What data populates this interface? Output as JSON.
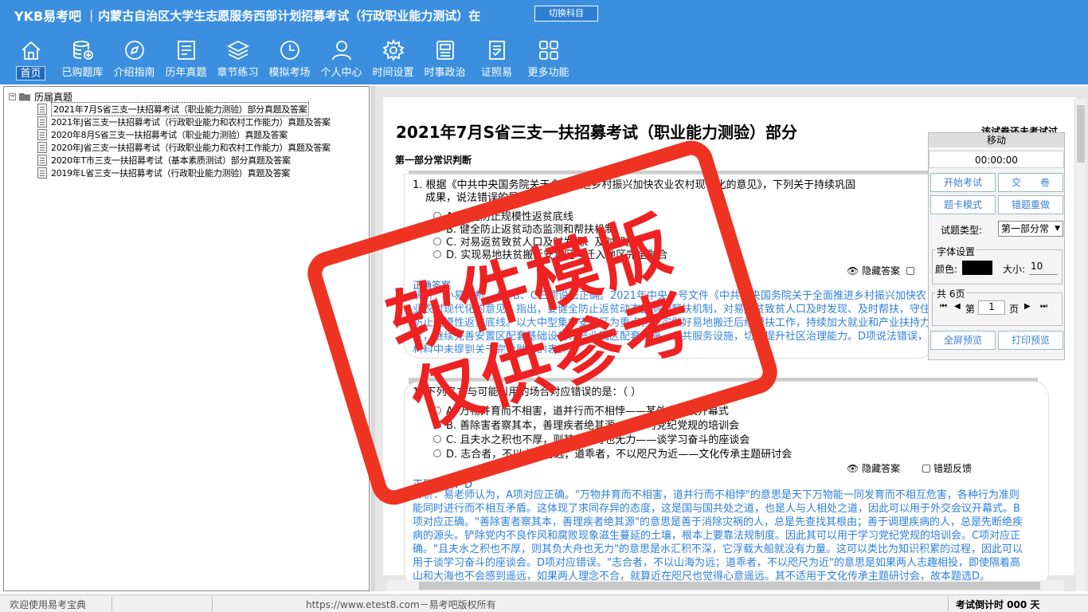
{
  "header": {
    "logo": "YKB易考吧",
    "title": "内蒙古自治区大学生志愿服务西部计划招募考试（行政职业能力测试）在",
    "switch_label": "切换科目"
  },
  "nav": [
    {
      "label": "首页",
      "icon": "home-icon"
    },
    {
      "label": "已购题库",
      "icon": "database-icon"
    },
    {
      "label": "介绍指南",
      "icon": "compass-icon"
    },
    {
      "label": "历年真题",
      "icon": "paper-list-icon"
    },
    {
      "label": "章节练习",
      "icon": "layers-icon"
    },
    {
      "label": "模拟考场",
      "icon": "clock-icon"
    },
    {
      "label": "个人中心",
      "icon": "user-icon"
    },
    {
      "label": "时间设置",
      "icon": "gear-icon"
    },
    {
      "label": "时事政治",
      "icon": "newspaper-icon"
    },
    {
      "label": "证照易",
      "icon": "certificate-icon"
    },
    {
      "label": "更多功能",
      "icon": "grid-icon"
    }
  ],
  "tree": {
    "root": "历届真题",
    "items": [
      "2021年7月S省三支一扶招募考试（职业能力测验）部分真题及答案",
      "2021年J省三支一扶招募考试（行政职业能力和农村工作能力）真题及答案",
      "2020年8月S省三支一扶招募考试（职业能力测验）真题及答案",
      "2020年J省三支一扶招募考试（行政职业能力和农村工作能力）真题及答案",
      "2020年T市三支一扶招募考试（基本素质测试）部分真题及答案",
      "2019年L省三支一扶招募考试（行政职业能力测验）真题及答案"
    ]
  },
  "paper": {
    "title": "2021年7月S省三支一扶招募考试（职业能力测验）部分",
    "status": "该试卷还未考试过",
    "section": "第一部分常识判断",
    "q1": {
      "line1": "1. 根据《中共中央国务院关于全面推进乡村振兴加快农业农村现代化的意见》，下列关于持续巩固",
      "line2": "成果，说法错误的是：（  ）",
      "options": [
        "A. 守住防止规模性返贫底线",
        "B. 健全防止返贫动态监测和帮扶机制",
        "C. 对易返贫致贫人口及时发现、及时帮扶",
        "D. 实现易地扶贫搬迁安置区与迁入地区完全融合"
      ],
      "hide": "隐藏答案",
      "answer_label": "正确答案",
      "expl": "解析：小易解析，A、B、C三项说法正确。2021年中央一号文件《中共中央国务院关于全面推进乡村振兴加快农业农村现代化的意见》指出，要健全防止返贫动态监测和帮扶机制，对易返贫致贫人口及时发现、及时帮扶，守住防止规模性返贫底线。以大中型集中安置区为重点，扎实做好易地搬迁后续帮扶工作，持续加大就业和产业扶持力度，继续完善安置区配套基础设施、产业园区配套设施、公共服务设施，切实提升社区治理能力。D项说法错误，材料中未提到关于完全融合的表述。"
    },
    "q2": {
      "line1": "1. 下列名言与可能引用的场合对应错误的是：（  ）",
      "options": [
        "A. 万物并育而不相害，道并行而不相悖——某外交会议开幕式",
        "B. 善除害者察其本，善理疾者绝其源——学习党纪党规的培训会",
        "C. 且夫水之积也不厚，则其负大舟也无力——谈学习奋斗的座谈会",
        "D. 志合者，不以山海为远；道乖者，不以咫尺为近——文化传承主题研讨会"
      ],
      "hide": "隐藏答案",
      "feedback": "错题反馈",
      "answer": "正确答案：D",
      "expl": "解析：易老师认为，A项对应正确。\"万物并育而不相害，道并行而不相悖\"的意思是天下万物能一同发育而不相互危害，各种行为准则能同时进行而不相互矛盾。这体现了求同存异的态度，这是国与国共处之道，也是人与人相处之道，因此可以用于外交会议开幕式。B项对应正确。\"善除害者察其本，善理疾者绝其源\"的意思是善于消除灾祸的人，总是先查找其根由；善于调理疾病的人，总是先断绝疾病的源头。铲除党内不良作风和腐败现象滋生蔓延的土壤，根本上要靠法规制度。因此其可以用于学习党纪党规的培训会。C项对应正确。\"且夫水之积也不厚，则其负大舟也无力\"的意思是水汇积不深，它浮载大船就没有力量。这可以类比为知识积累的过程，因此可以用于谈学习奋斗的座谈会。D项对应错误。\"志合者，不以山海为远；道乖者，不以咫尺为近\"的意思是如果两人志趣相投，即使隔着高山和大海也不会感到遥远，如果两人理念不合，就算近在咫尺也觉得心意遥远。其不适用于文化传承主题研讨会，故本题选D。"
    }
  },
  "panel": {
    "header": "移动",
    "timer": "00:00:00",
    "start": "开始考试",
    "submit": "交　　卷",
    "card_mode": "题卡模式",
    "redo": "错题重做",
    "qtype_label": "试题类型:",
    "qtype_value": "第一部分常",
    "font_title": "字体设置",
    "color_label": "颜色:",
    "size_label": "大小:",
    "size_value": "10",
    "pages_title": "共 6页",
    "first": "⏮",
    "prev": "◀",
    "page_prefix": "第",
    "page_value": "1",
    "page_suffix": "页",
    "next": "▶",
    "last": "⏭",
    "fullscreen": "全屏预览",
    "print": "打印预览"
  },
  "status": {
    "welcome": "欢迎使用易考宝典",
    "url": "https://www.etest8.com－易考吧版权所有",
    "countdown": "考试倒计时 000 天"
  },
  "watermark": {
    "line1": "软件模版",
    "line2": "仅供参考"
  }
}
